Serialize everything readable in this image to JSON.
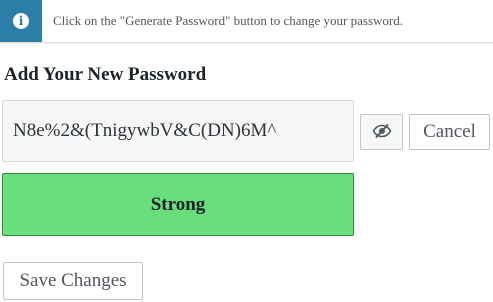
{
  "notice": {
    "icon": "info-icon",
    "icon_glyph": "i",
    "text": "Click on the \"Generate Password\" button to change your password.",
    "accent_color": "#2a7ea8"
  },
  "form": {
    "heading": "Add Your New Password",
    "password_value": "N8e%2&(TnigywbV&C(DN)6M^",
    "hide_password_icon": "eye-slash-icon",
    "cancel_label": "Cancel",
    "strength_label": "Strong",
    "strength_color": "#68de7c",
    "save_label": "Save Changes"
  }
}
